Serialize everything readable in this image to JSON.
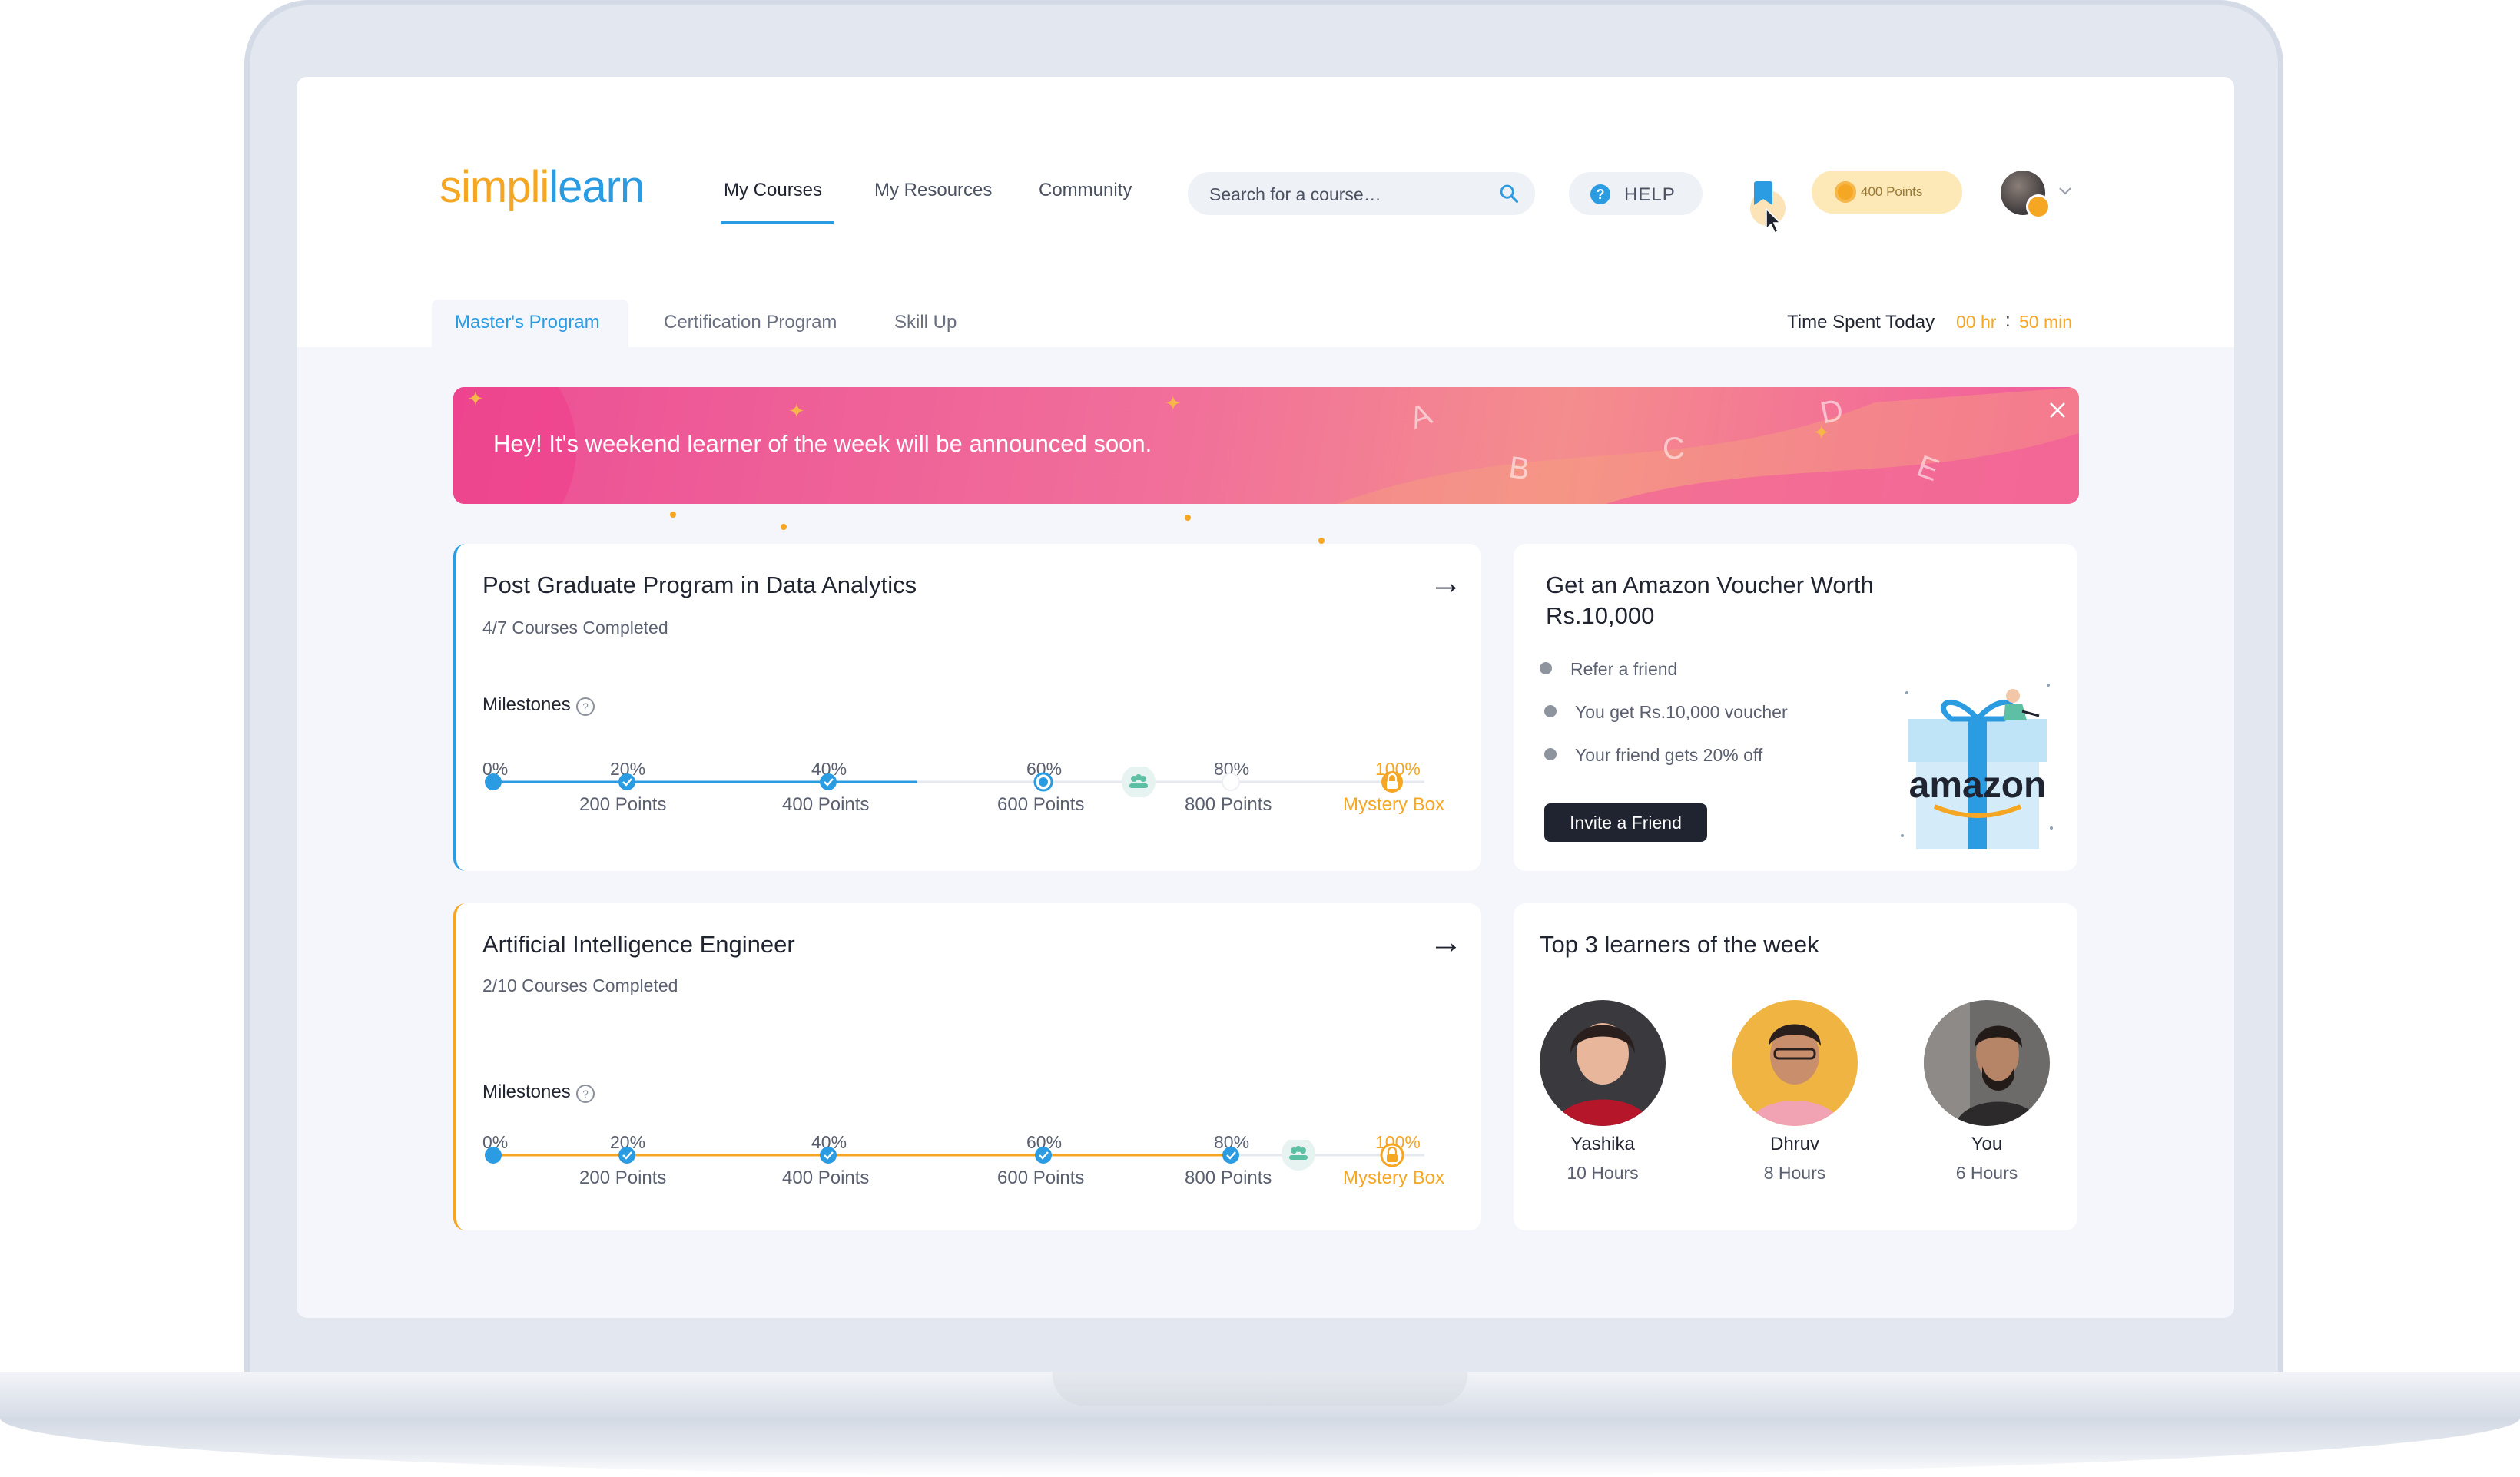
{
  "brand": {
    "logo_part1": "simpli",
    "logo_part2": "learn",
    "primary": "#2b9be2",
    "accent": "#f5a623",
    "banner_pink": "#ec4f95"
  },
  "navbar": {
    "links": [
      "My Courses",
      "My Resources",
      "Community"
    ],
    "active_link": "My Courses",
    "search_placeholder": "Search for a course…",
    "help_label": "HELP",
    "points_label": "400 Points",
    "icons": [
      "search-icon",
      "help-icon",
      "bookmark-icon",
      "coin-icon",
      "chevron-down-icon"
    ]
  },
  "tabs": {
    "items": [
      "Master's Program",
      "Certification Program",
      "Skill Up"
    ],
    "active": "Master's Program",
    "time_label": "Time Spent Today",
    "time_hours": "00 hr",
    "time_separator": ":",
    "time_minutes": "50 min"
  },
  "banner": {
    "message": "Hey! It's weekend learner of the week will be announced soon.",
    "letters": [
      "A",
      "B",
      "C",
      "D",
      "E"
    ]
  },
  "courses": [
    {
      "title": "Post Graduate Program in Data Analytics",
      "progress": "4/7 Courses Completed",
      "milestones_label": "Milestones",
      "milestone_percents": [
        "0%",
        "20%",
        "40%",
        "60%",
        "80%",
        "100%"
      ],
      "milestone_points": [
        "200 Points",
        "400 Points",
        "600 Points",
        "800 Points",
        "Mystery Box"
      ],
      "completed_fraction": 0.5,
      "accent": "#2b9be2"
    },
    {
      "title": "Artificial Intelligence Engineer",
      "progress": "2/10 Courses Completed",
      "milestones_label": "Milestones",
      "milestone_percents": [
        "0%",
        "20%",
        "40%",
        "60%",
        "80%",
        "100%"
      ],
      "milestone_points": [
        "200 Points",
        "400 Points",
        "600 Points",
        "800 Points",
        "Mystery Box"
      ],
      "completed_fraction": 0.8,
      "accent": "#f5a623"
    }
  ],
  "voucher": {
    "title_line1": "Get an Amazon Voucher Worth",
    "title_line2": "Rs.10,000",
    "bullets": [
      "Refer a friend",
      "You get Rs.10,000 voucher",
      "Your friend gets 20% off"
    ],
    "button_label": "Invite a Friend",
    "gift_brand": "amazon"
  },
  "leaderboard": {
    "title": "Top 3 learners of the week",
    "learners": [
      {
        "name": "Yashika",
        "hours": "10 Hours"
      },
      {
        "name": "Dhruv",
        "hours": "8 Hours"
      },
      {
        "name": "You",
        "hours": "6 Hours"
      }
    ]
  }
}
